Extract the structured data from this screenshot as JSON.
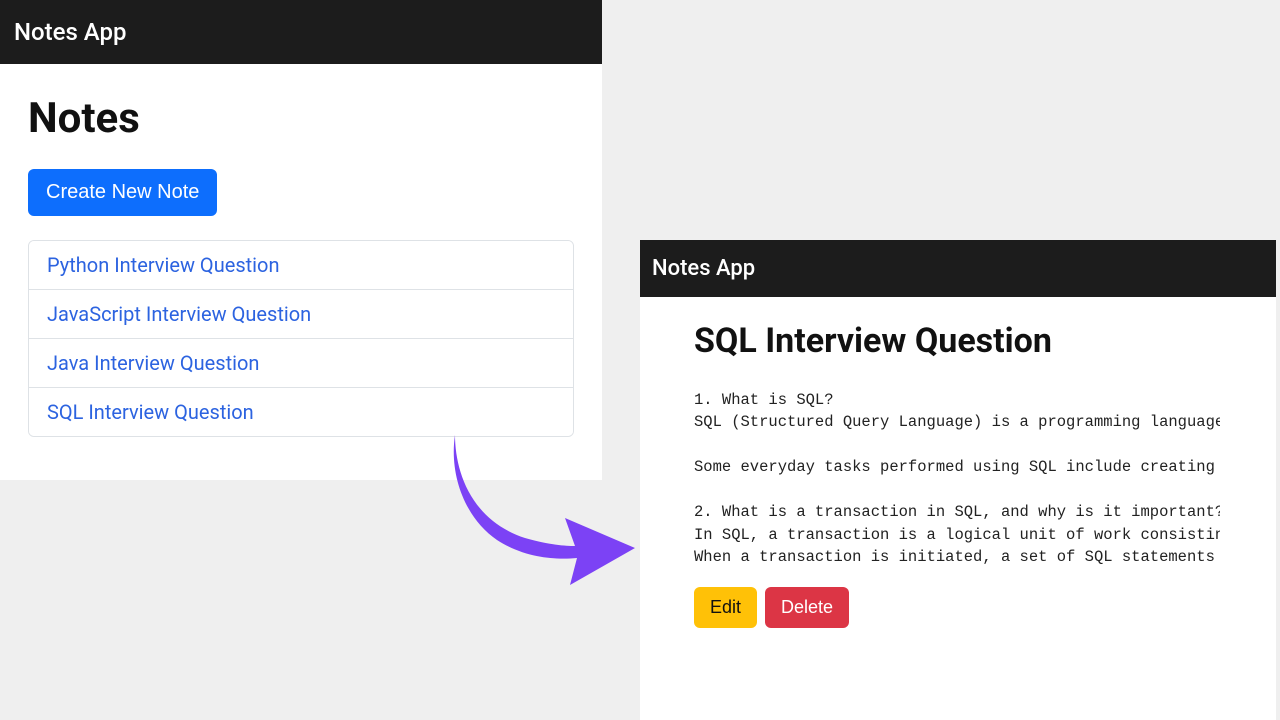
{
  "left": {
    "app_title": "Notes App",
    "page_title": "Notes",
    "create_button": "Create New Note",
    "notes": [
      "Python Interview Question",
      "JavaScript Interview Question",
      "Java Interview Question",
      "SQL Interview Question"
    ]
  },
  "right": {
    "app_title": "Notes App",
    "note_title": "SQL Interview Question",
    "note_body": "1. What is SQL?\nSQL (Structured Query Language) is a programming language used to manage and manipulate relational databases.\n\nSome everyday tasks performed using SQL include creating tables, inserting data, querying data, updating records, and deleting records.\n\n2. What is a transaction in SQL, and why is it important?\nIn SQL, a transaction is a logical unit of work consisting of one or more SQL statements executed as a single operation.\nWhen a transaction is initiated, a set of SQL statements are executed together, and the changes are committed only if all statements succeed.",
    "edit_label": "Edit",
    "delete_label": "Delete"
  }
}
